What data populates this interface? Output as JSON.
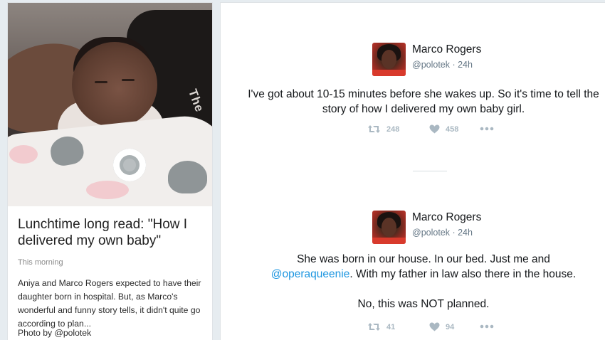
{
  "story": {
    "title": "Lunchtime long read: \"How I delivered my own baby\"",
    "time": "This morning",
    "summary": "Aniya and Marco Rogers expected to have their daughter born in hospital. But, as Marco's wonderful and funny story tells, it didn't quite go according to plan...",
    "credit_prefix": "Photo by ",
    "credit_handle": "@polotek",
    "photo_text": "The"
  },
  "tweets": [
    {
      "name": "Marco Rogers",
      "handle_time": "@polotek · 24h",
      "text": "I've got about 10-15 minutes before she wakes up. So it's time to tell the story of how I delivered my own baby girl.",
      "retweets": "248",
      "likes": "458"
    },
    {
      "name": "Marco Rogers",
      "handle_time": "@polotek · 24h",
      "text_line1": "She was born in our house. In our bed. Just me and",
      "mention": "@operaqueenie",
      "text_line2": ". With my father in law also there in the house.",
      "text_line3": "No, this was NOT planned.",
      "retweets": "41",
      "likes": "94"
    }
  ],
  "colors": {
    "accent": "#1b95e0",
    "action_gray": "#aab8c2",
    "background": "#e6ecf0"
  },
  "icons": [
    "retweet-icon",
    "heart-icon",
    "more-icon"
  ]
}
